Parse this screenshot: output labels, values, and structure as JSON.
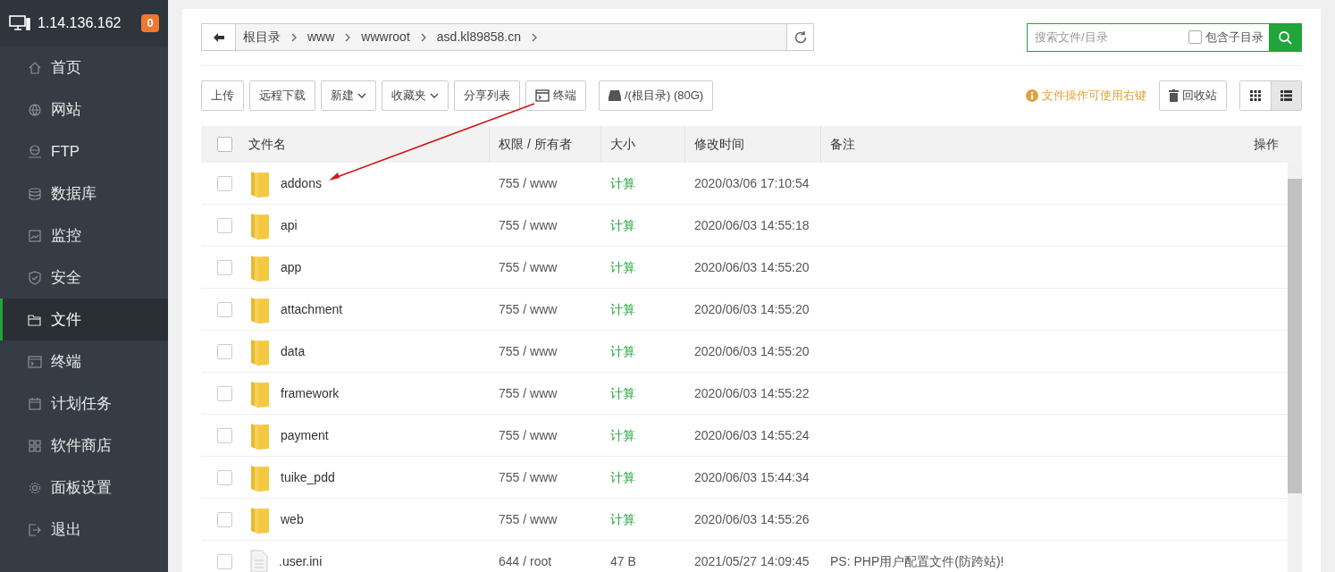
{
  "sidebar": {
    "server": "1.14.136.162",
    "badge": "0",
    "items": [
      {
        "label": "首页",
        "selected": false
      },
      {
        "label": "网站",
        "selected": false
      },
      {
        "label": "FTP",
        "selected": false
      },
      {
        "label": "数据库",
        "selected": false
      },
      {
        "label": "监控",
        "selected": false
      },
      {
        "label": "安全",
        "selected": false
      },
      {
        "label": "文件",
        "selected": true
      },
      {
        "label": "终端",
        "selected": false
      },
      {
        "label": "计划任务",
        "selected": false
      },
      {
        "label": "软件商店",
        "selected": false
      },
      {
        "label": "面板设置",
        "selected": false
      },
      {
        "label": "退出",
        "selected": false
      }
    ]
  },
  "path_bar": {
    "crumbs": [
      "根目录",
      "www",
      "wwwroot",
      "asd.kl89858.cn"
    ]
  },
  "search": {
    "placeholder": "搜索文件/目录",
    "include_subdirs": {
      "label": "包含子目录",
      "checked": false
    }
  },
  "toolbar": {
    "buttons": [
      {
        "label": "上传",
        "kind": "plain"
      },
      {
        "label": "远程下载",
        "kind": "plain"
      },
      {
        "label": "新建",
        "kind": "dropdown"
      },
      {
        "label": "收藏夹",
        "kind": "dropdown"
      },
      {
        "label": "分享列表",
        "kind": "plain"
      },
      {
        "label": "终端",
        "kind": "terminal"
      },
      {
        "label": "/(根目录) (80G)",
        "kind": "disk"
      }
    ],
    "hint": "文件操作可使用右键",
    "recycle": "回收站",
    "views": [
      {
        "kind": "grid",
        "selected": false
      },
      {
        "kind": "list",
        "selected": true
      }
    ]
  },
  "table": {
    "select_all": {
      "checked": false
    },
    "columns": [
      "文件名",
      "权限 / 所有者",
      "大小",
      "修改时间",
      "备注",
      "操作"
    ],
    "rows": [
      {
        "kind": "folder",
        "name": "addons",
        "perm": "755 / www",
        "size": "计算",
        "time": "2020/03/06 17:10:54",
        "note": "",
        "checked": false
      },
      {
        "kind": "folder",
        "name": "api",
        "perm": "755 / www",
        "size": "计算",
        "time": "2020/06/03 14:55:18",
        "note": "",
        "checked": false
      },
      {
        "kind": "folder",
        "name": "app",
        "perm": "755 / www",
        "size": "计算",
        "time": "2020/06/03 14:55:20",
        "note": "",
        "checked": false
      },
      {
        "kind": "folder",
        "name": "attachment",
        "perm": "755 / www",
        "size": "计算",
        "time": "2020/06/03 14:55:20",
        "note": "",
        "checked": false
      },
      {
        "kind": "folder",
        "name": "data",
        "perm": "755 / www",
        "size": "计算",
        "time": "2020/06/03 14:55:20",
        "note": "",
        "checked": false
      },
      {
        "kind": "folder",
        "name": "framework",
        "perm": "755 / www",
        "size": "计算",
        "time": "2020/06/03 14:55:22",
        "note": "",
        "checked": false
      },
      {
        "kind": "folder",
        "name": "payment",
        "perm": "755 / www",
        "size": "计算",
        "time": "2020/06/03 14:55:24",
        "note": "",
        "checked": false
      },
      {
        "kind": "folder",
        "name": "tuike_pdd",
        "perm": "755 / www",
        "size": "计算",
        "time": "2020/06/03 15:44:34",
        "note": "",
        "checked": false
      },
      {
        "kind": "folder",
        "name": "web",
        "perm": "755 / www",
        "size": "计算",
        "time": "2020/06/03 14:55:26",
        "note": "",
        "checked": false
      },
      {
        "kind": "file",
        "name": ".user.ini",
        "perm": "644 / root",
        "size": "47 B",
        "time": "2021/05/27 14:09:45",
        "note": "PS: PHP用户配置文件(防跨站)!",
        "checked": false
      }
    ]
  }
}
